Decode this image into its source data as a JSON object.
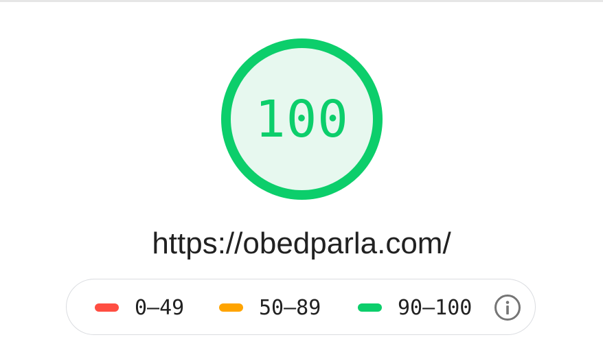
{
  "report": {
    "score": "100",
    "score_color": "#0cce6b",
    "score_fill_fraction": 1.0,
    "url": "https://obedparla.com/"
  },
  "legend": {
    "items": [
      {
        "label": "0–49",
        "color": "#ff4e42"
      },
      {
        "label": "50–89",
        "color": "#ffa400"
      },
      {
        "label": "90–100",
        "color": "#0cce6b"
      }
    ],
    "info_icon": "info-icon"
  }
}
